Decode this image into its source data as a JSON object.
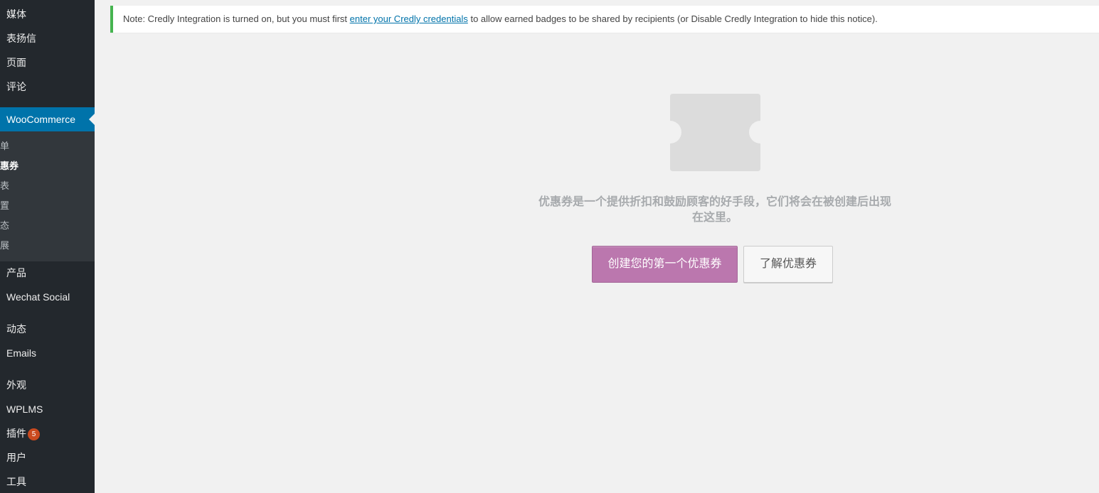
{
  "sidebar": {
    "items_top": [
      {
        "label": "媒体"
      },
      {
        "label": "表扬信"
      },
      {
        "label": "页面"
      },
      {
        "label": "评论"
      }
    ],
    "active": {
      "label": "WooCommerce"
    },
    "submenu": [
      {
        "label": "单"
      },
      {
        "label": "惠券"
      },
      {
        "label": "表"
      },
      {
        "label": "置"
      },
      {
        "label": "态"
      },
      {
        "label": "展"
      }
    ],
    "items_bottom": [
      {
        "label": "产品"
      },
      {
        "label": "Wechat Social"
      },
      {
        "label": "动态"
      },
      {
        "label": "Emails"
      },
      {
        "label": "外观"
      },
      {
        "label": "WPLMS"
      },
      {
        "label": "插件",
        "badge": "5"
      },
      {
        "label": "用户"
      },
      {
        "label": "工具"
      }
    ]
  },
  "notice": {
    "prefix": "Note: Credly Integration is turned on, but you must first ",
    "link": "enter your Credly credentials",
    "suffix": " to allow earned badges to be shared by recipients (or Disable Credly Integration to hide this notice)."
  },
  "empty_state": {
    "icon": "coupon-icon",
    "message": "优惠券是一个提供折扣和鼓励顾客的好手段，它们将会在被创建后出现在这里。",
    "primary_button": "创建您的第一个优惠券",
    "secondary_button": "了解优惠券"
  },
  "colors": {
    "sidebar_bg": "#23282d",
    "active_menu": "#0073aa",
    "notice_border": "#46b450",
    "primary_button": "#bb77ae",
    "badge": "#ca4a1f"
  }
}
